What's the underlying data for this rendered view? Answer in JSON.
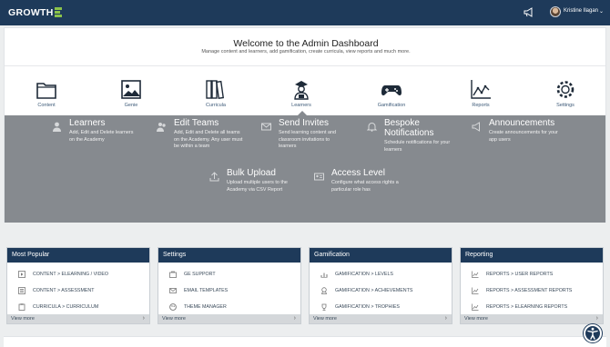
{
  "brand": {
    "logo_text": "GROWTH"
  },
  "topbar": {
    "username": "Kristine Ilagan",
    "caret": "⌄",
    "megaphone_icon": "megaphone-icon"
  },
  "welcome": {
    "title": "Welcome to the Admin Dashboard",
    "subtitle": "Manage content and learners, add gamification, create curricula, view reports and much more."
  },
  "categories": [
    {
      "label": "Content",
      "icon": "folder-icon"
    },
    {
      "label": "Genie",
      "icon": "image-icon"
    },
    {
      "label": "Curricula",
      "icon": "books-icon"
    },
    {
      "label": "Learners",
      "icon": "learner-icon"
    },
    {
      "label": "Gamification",
      "icon": "gamepad-icon"
    },
    {
      "label": "Reports",
      "icon": "chart-icon"
    },
    {
      "label": "Settings",
      "icon": "gear-icon"
    }
  ],
  "learners_menu": [
    {
      "title": "Learners",
      "desc_lines": [
        "Add, Edit and Delete learners",
        "on the Academy"
      ],
      "icon": "user-icon"
    },
    {
      "title": "Edit Teams",
      "desc_lines": [
        "Add, Edit and Delete all teams",
        "on the Academy. Any user must",
        "be within a team"
      ],
      "icon": "users-icon"
    },
    {
      "title": "Send Invites",
      "desc_lines": [
        "Send learning content and",
        "classroom invitations to",
        "learners"
      ],
      "icon": "envelope-icon"
    },
    {
      "title_lines": [
        "Bespoke",
        "Notifications"
      ],
      "desc_lines": [
        "Schedule notifications for your",
        "learners"
      ],
      "icon": "bell-icon"
    },
    {
      "title": "Announcements",
      "desc_lines": [
        "Create announcements for your",
        "app users"
      ],
      "icon": "megaphone-icon"
    },
    {
      "title": "Bulk Upload",
      "desc_lines": [
        "Upload multiple users to the",
        "Academy via CSV Report"
      ],
      "icon": "upload-icon"
    },
    {
      "title": "Access Level",
      "desc_lines": [
        "Configure what access rights a",
        "particular role has"
      ],
      "icon": "id-card-icon"
    }
  ],
  "panels": [
    {
      "title": "Most Popular",
      "rows": [
        {
          "label": "CONTENT > ELEARNING / VIDEO",
          "icon": "video-icon"
        },
        {
          "label": "CONTENT > ASSESSMENT",
          "icon": "checklist-icon"
        },
        {
          "label": "CURRICULA > CURRICULUM",
          "icon": "clipboard-icon"
        }
      ],
      "more": "View more"
    },
    {
      "title": "Settings",
      "rows": [
        {
          "label": "GE SUPPORT",
          "icon": "support-icon"
        },
        {
          "label": "EMAIL TEMPLATES",
          "icon": "envelope-icon"
        },
        {
          "label": "THEME MANAGER",
          "icon": "palette-icon"
        }
      ],
      "more": "View more"
    },
    {
      "title": "Gamification",
      "rows": [
        {
          "label": "GAMIFICATION > LEVELS",
          "icon": "levels-icon"
        },
        {
          "label": "GAMIFICATION > ACHIEVEMENTS",
          "icon": "medal-icon"
        },
        {
          "label": "GAMIFICATION > TROPHIES",
          "icon": "trophy-icon"
        }
      ],
      "more": "View more"
    },
    {
      "title": "Reporting",
      "rows": [
        {
          "label": "REPORTS > USER REPORTS",
          "icon": "chart-icon"
        },
        {
          "label": "REPORTS > ASSESSMENT REPORTS",
          "icon": "chart-icon"
        },
        {
          "label": "REPORTS > ELEARNING REPORTS",
          "icon": "chart-icon"
        }
      ],
      "more": "View more"
    }
  ],
  "colors": {
    "topbar": "#1e3a5a",
    "accent_green": "#8bc34a",
    "dropdown_bg": "#868a8f"
  }
}
